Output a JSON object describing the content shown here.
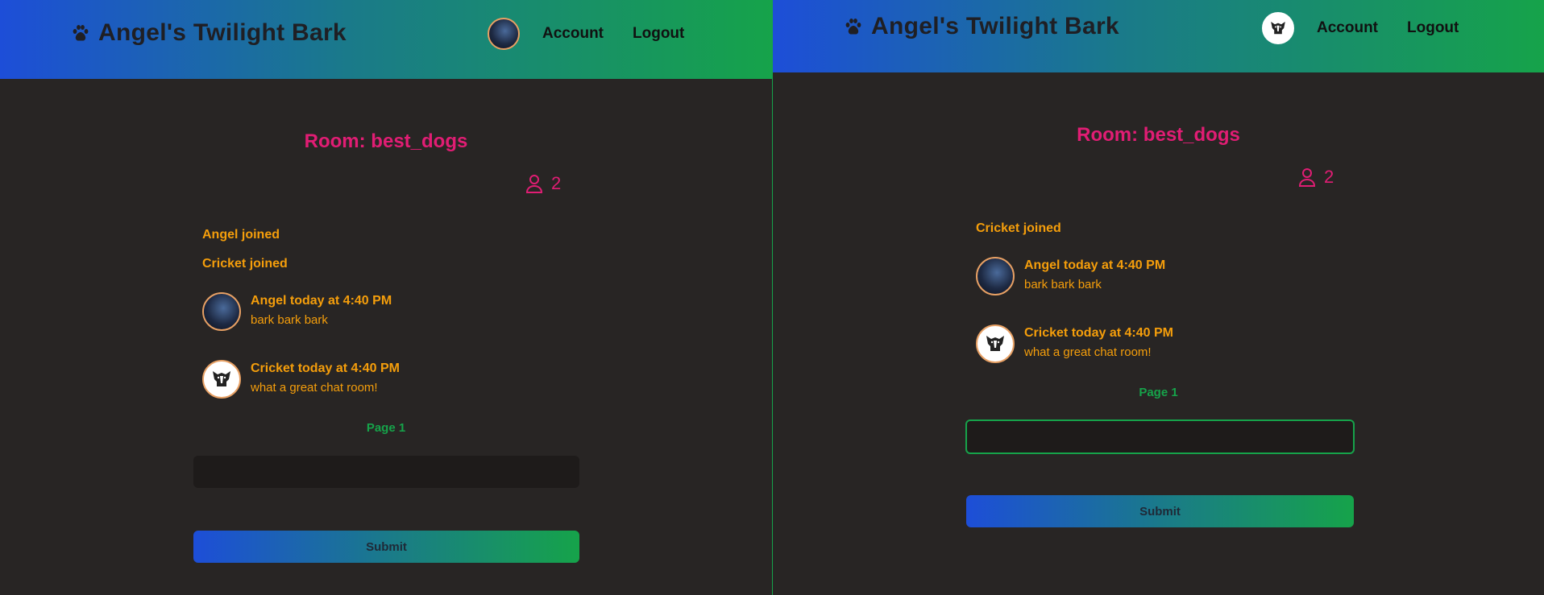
{
  "colors": {
    "accent_pink": "#e11d74",
    "accent_orange": "#f59e0b",
    "accent_green": "#16a34a",
    "accent_blue": "#1d4ed8",
    "background": "#282524"
  },
  "navbar": {
    "brand_icon": "paw-icon",
    "brand": "Angel's Twilight Bark",
    "account_label": "Account",
    "logout_label": "Logout"
  },
  "left": {
    "room_title": "Room: best_dogs",
    "user_count": "2",
    "events": [
      "Angel joined",
      "Cricket joined"
    ],
    "messages": [
      {
        "header": "Angel today at 4:40 PM",
        "body": "bark bark bark"
      },
      {
        "header": "Cricket today at 4:40 PM",
        "body": "what a great chat room!"
      }
    ],
    "page_label": "Page 1",
    "input_value": "",
    "submit_label": "Submit"
  },
  "right": {
    "room_title": "Room: best_dogs",
    "user_count": "2",
    "events": [
      "Cricket joined"
    ],
    "messages": [
      {
        "header": "Angel today at 4:40 PM",
        "body": "bark bark bark"
      },
      {
        "header": "Cricket today at 4:40 PM",
        "body": "what a great chat room!"
      }
    ],
    "page_label": "Page 1",
    "input_value": "",
    "submit_label": "Submit"
  }
}
